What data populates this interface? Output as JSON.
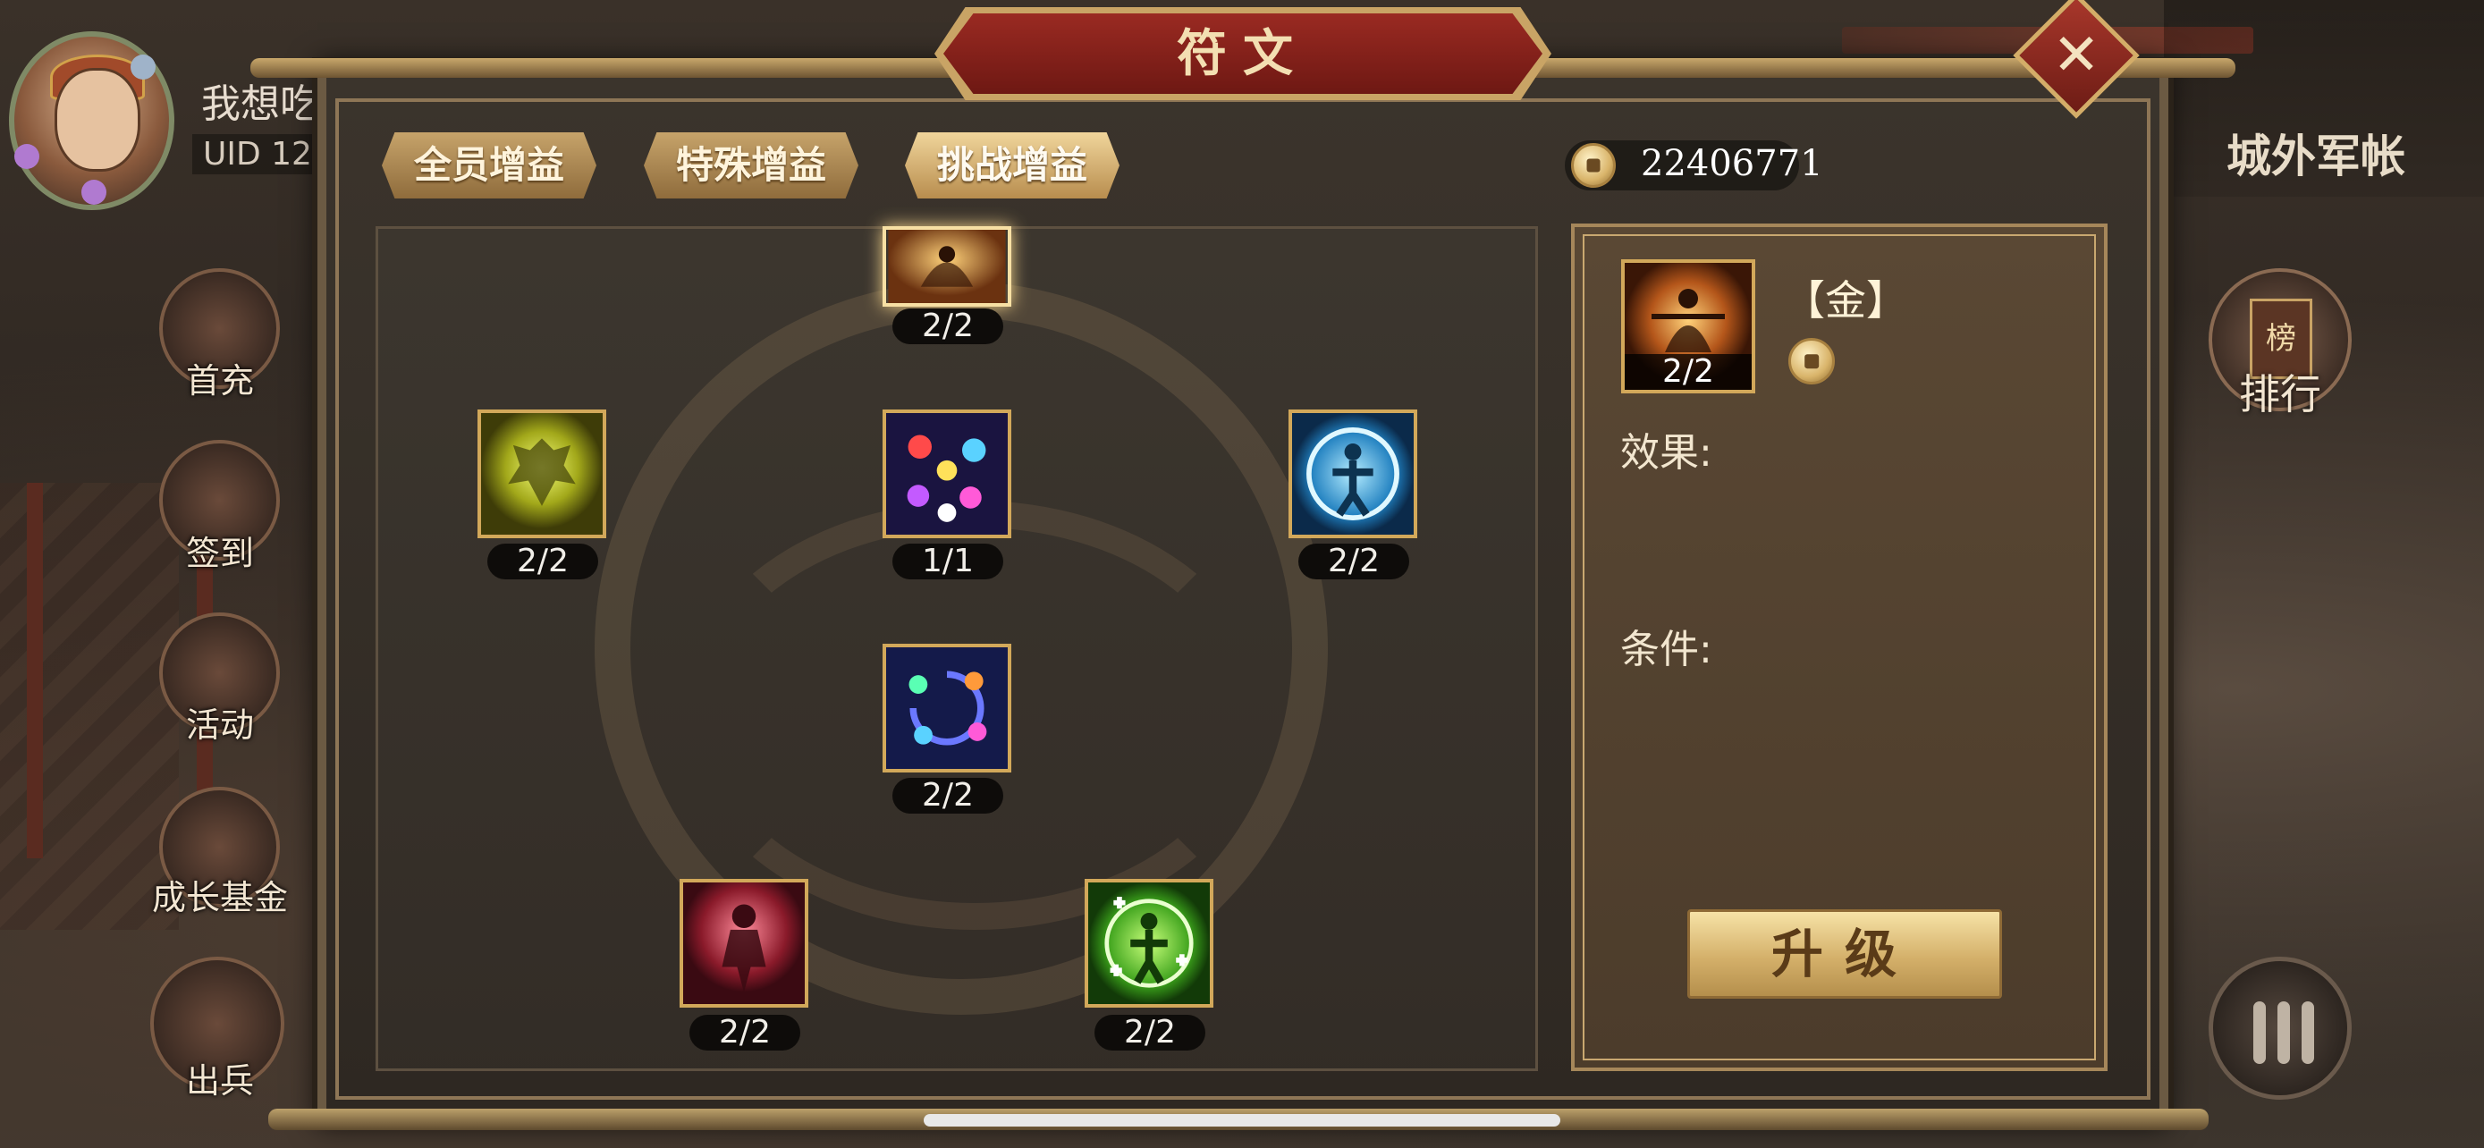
{
  "hud": {
    "player_name": "我想吃",
    "uid_label": "UID  12",
    "side_menu": [
      {
        "id": "first-charge",
        "label": "首充"
      },
      {
        "id": "sign-in",
        "label": "签到"
      },
      {
        "id": "activity",
        "label": "活动"
      },
      {
        "id": "growth-fund",
        "label": "成长基金"
      },
      {
        "id": "deploy",
        "label": "出兵"
      }
    ],
    "location_title": "城外军帐",
    "rank_label": "排行",
    "rank_board_char": "榜"
  },
  "modal": {
    "title": "符文",
    "close_symbol": "✕",
    "tabs": [
      {
        "label": "全员增益",
        "active": false
      },
      {
        "label": "特殊增益",
        "active": false
      },
      {
        "label": "挑战增益",
        "active": true
      }
    ],
    "currency": {
      "icon": "coin-icon",
      "amount": "22406771"
    }
  },
  "rune_tree": {
    "nodes": [
      {
        "id": "gold",
        "progress": "2/2",
        "theme": "gold-figure",
        "selected": true
      },
      {
        "id": "yellow-warrior",
        "progress": "2/2",
        "theme": "yellow-burst"
      },
      {
        "id": "star-orbs",
        "progress": "1/1",
        "theme": "multicolor-orbs"
      },
      {
        "id": "blue-figure",
        "progress": "2/2",
        "theme": "blue-ring"
      },
      {
        "id": "spiral-orbs",
        "progress": "2/2",
        "theme": "spiral-orbs"
      },
      {
        "id": "red-warrior",
        "progress": "2/2",
        "theme": "red-figure"
      },
      {
        "id": "green-heal",
        "progress": "2/2",
        "theme": "green-heal"
      }
    ]
  },
  "detail": {
    "name": "【金】",
    "progress": "2/2",
    "effect_label": "效果:",
    "condition_label": "条件:",
    "upgrade_label": "升级"
  },
  "colors": {
    "banner_red": "#8a2219",
    "gold_trim": "#d2a85a",
    "panel_brown": "#544230"
  }
}
